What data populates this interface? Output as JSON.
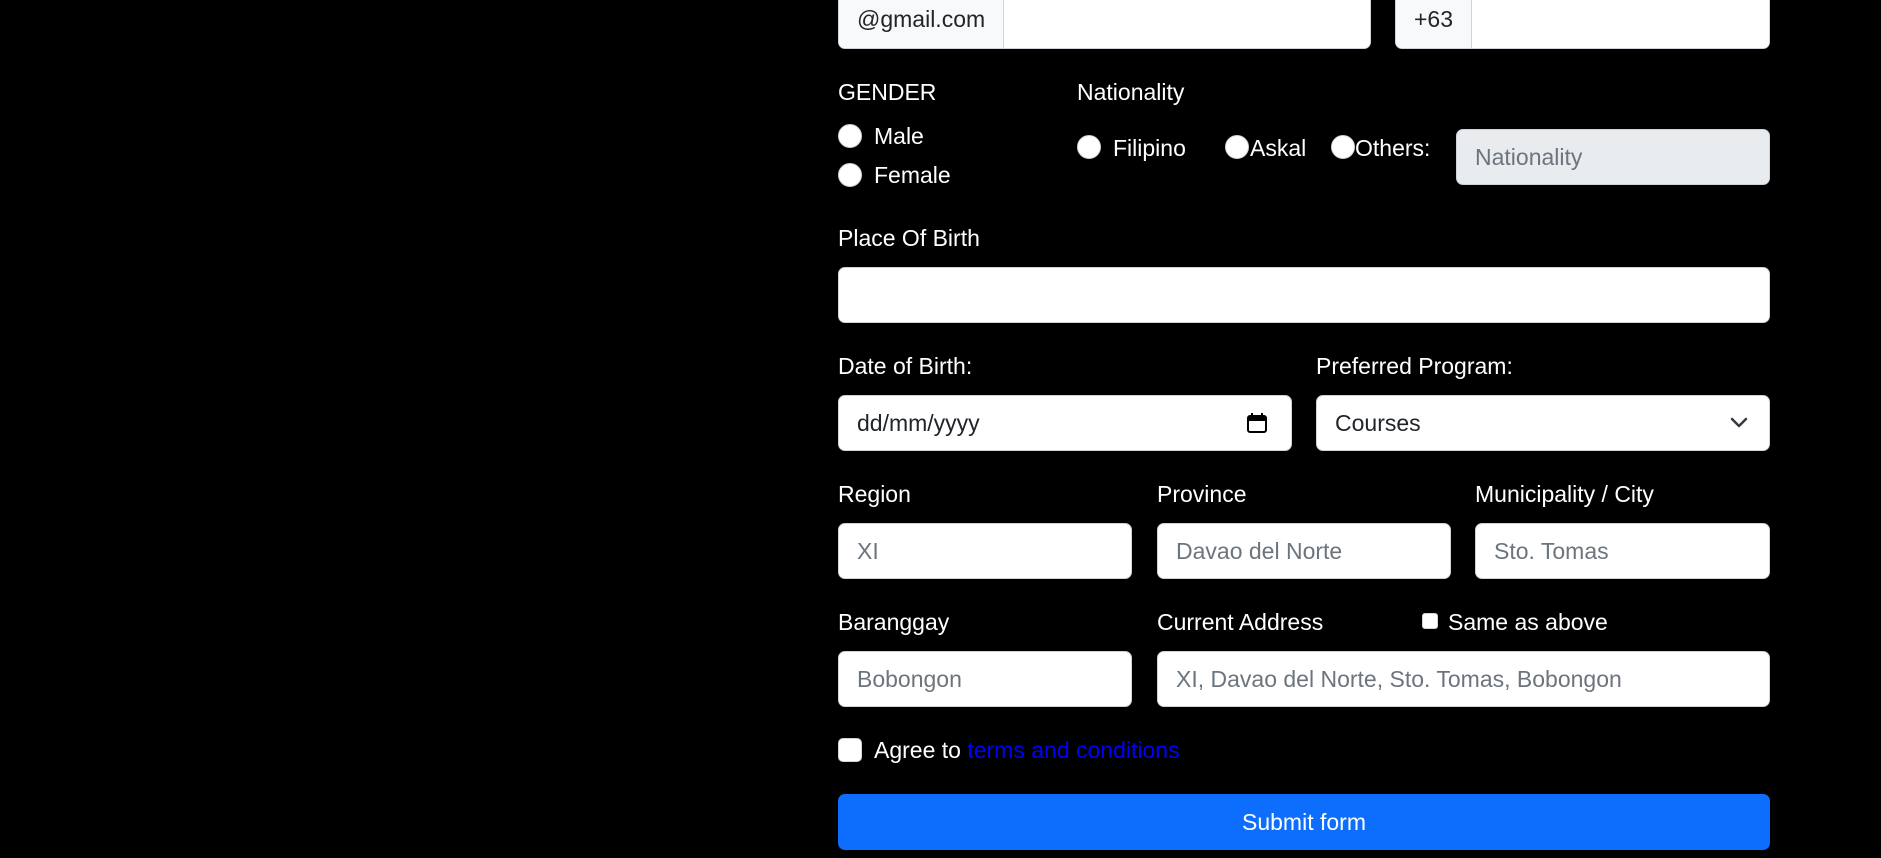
{
  "contact": {
    "email_suffix": "@gmail.com",
    "phone_prefix": "+63"
  },
  "gender": {
    "label": "GENDER",
    "options": [
      "Male",
      "Female"
    ]
  },
  "nationality": {
    "label": "Nationality",
    "options": [
      "Filipino",
      "Askal",
      "Others:"
    ],
    "other_placeholder": "Nationality"
  },
  "place_of_birth": {
    "label": "Place Of Birth",
    "value": ""
  },
  "date_of_birth": {
    "label": "Date of Birth:",
    "placeholder": "dd/mm/yyyy"
  },
  "preferred_program": {
    "label": "Preferred Program:",
    "selected": "Courses"
  },
  "region": {
    "label": "Region",
    "placeholder": "XI"
  },
  "province": {
    "label": "Province",
    "placeholder": "Davao del Norte"
  },
  "municipality": {
    "label": "Municipality / City",
    "placeholder": "Sto. Tomas"
  },
  "barangay": {
    "label": "Baranggay",
    "placeholder": "Bobongon"
  },
  "current_address": {
    "label": "Current Address",
    "same_as_above_label": "Same as above",
    "placeholder": "XI, Davao del Norte, Sto. Tomas, Bobongon"
  },
  "agreement": {
    "prefix": "Agree to",
    "link_text": "terms and conditions"
  },
  "submit": {
    "label": "Submit form"
  },
  "colors": {
    "background": "#000000",
    "primary": "#0d6efd",
    "link": "#0000ff"
  }
}
